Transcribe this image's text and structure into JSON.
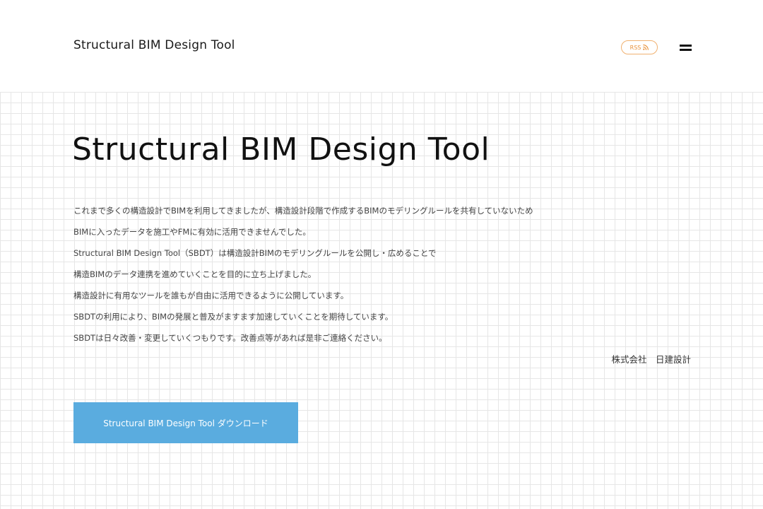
{
  "header": {
    "site_title": "Structural BIM Design Tool",
    "rss_label": "RSS",
    "menu_icon": "hamburger-menu-icon",
    "rss_color": "#e8913a"
  },
  "main": {
    "title": "Structural BIM Design Tool",
    "description_lines": [
      "これまで多くの構造設計でBIMを利用してきましたが、構造設計段階で作成するBIMのモデリングルールを共有していないため",
      "BIMに入ったデータを施工やFMに有効に活用できませんでした。",
      "Structural BIM Design Tool（SBDT）は構造設計BIMのモデリングルールを公開し・広めることで",
      "構造BIMのデータ連携を進めていくことを目的に立ち上げました。",
      "構造設計に有用なツールを誰もが自由に活用できるように公開しています。",
      "SBDTの利用により、BIMの発展と普及がますます加速していくことを期待しています。",
      "SBDTは日々改善・変更していくつもりです。改善点等があれば是非ご連絡ください。"
    ],
    "company": "株式会社　日建設計",
    "download_label": "Structural BIM Design Tool ダウンロード",
    "download_color": "#5aacdf"
  }
}
